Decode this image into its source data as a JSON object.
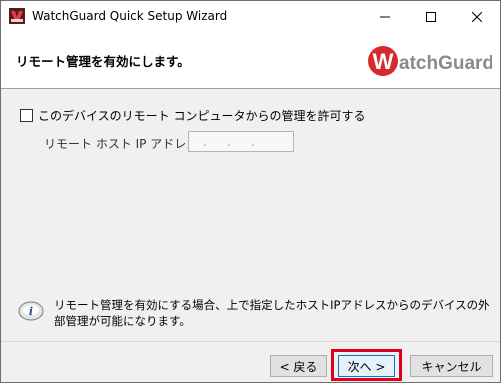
{
  "window": {
    "title": "WatchGuard Quick Setup Wizard",
    "controls": {
      "minimize": "minimize-icon",
      "maximize": "maximize-icon",
      "close": "close-icon"
    }
  },
  "header": {
    "title": "リモート管理を有効にします。",
    "logo": "WatchGuard"
  },
  "remote": {
    "checkbox_label": "このデバイスのリモート コンピュータからの管理を許可する",
    "checked": false,
    "ip_label": "リモート ホスト IP アドレス:",
    "ip_value": ". . ."
  },
  "info": {
    "text": "リモート管理を有効にする場合、上で指定したホストIPアドレスからのデバイスの外部管理が可能になります。"
  },
  "buttons": {
    "back": "< 戻る",
    "next": "次へ >",
    "cancel": "キャンセル"
  },
  "colors": {
    "highlight": "#e0001b",
    "logo_red": "#d62b2b",
    "logo_gray": "#8a8a8a"
  }
}
